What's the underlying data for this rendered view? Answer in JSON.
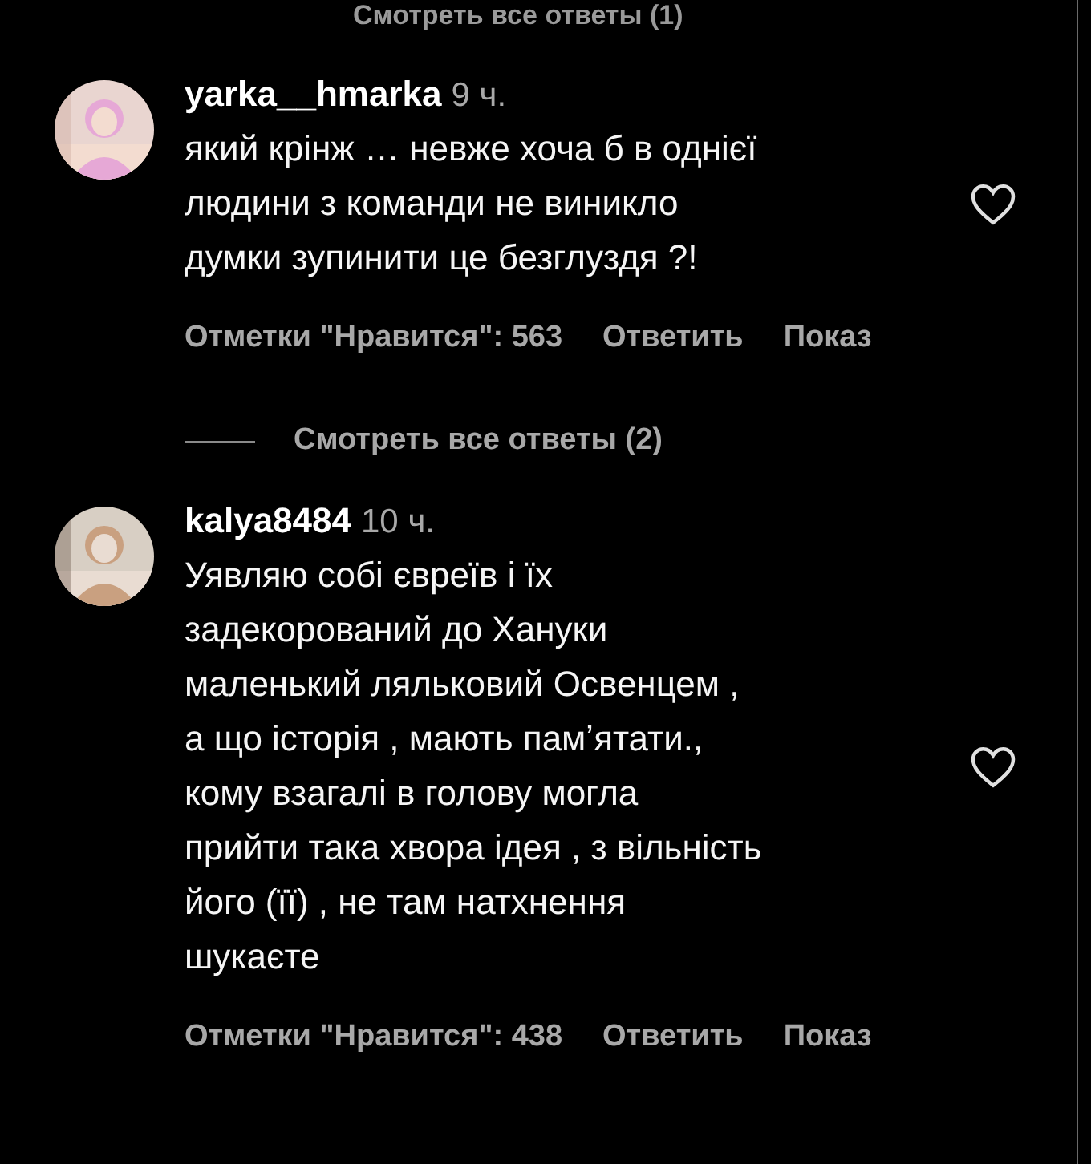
{
  "top_link": "Смотреть все ответы (1)",
  "comments": [
    {
      "username": "yarka__hmarka",
      "time": "9 ч.",
      "body_lines": [
        "який крінж … невже хоча б в однієї",
        "людини з команди не виникло",
        "думки зупинити це безглуздя ?!"
      ],
      "likes": "Отметки \"Нравится\": 563",
      "reply": "Ответить",
      "more": "Показ",
      "liked": false,
      "view_replies": "Смотреть все ответы (2)"
    },
    {
      "username": "kalya8484",
      "time": "10 ч.",
      "body_lines": [
        "Уявляю собі євреїв і їх",
        "задекорований до Хануки",
        "маленький ляльковий Освенцем ,",
        "а що історія , мають памʼятати.,",
        "кому взагалі в голову могла",
        "прийти така хвора ідея , з вільність",
        "його (її) , не там натхнення",
        "шукаєте"
      ],
      "likes": "Отметки \"Нравится\": 438",
      "reply": "Ответить",
      "more": "Показ",
      "liked": false
    }
  ]
}
